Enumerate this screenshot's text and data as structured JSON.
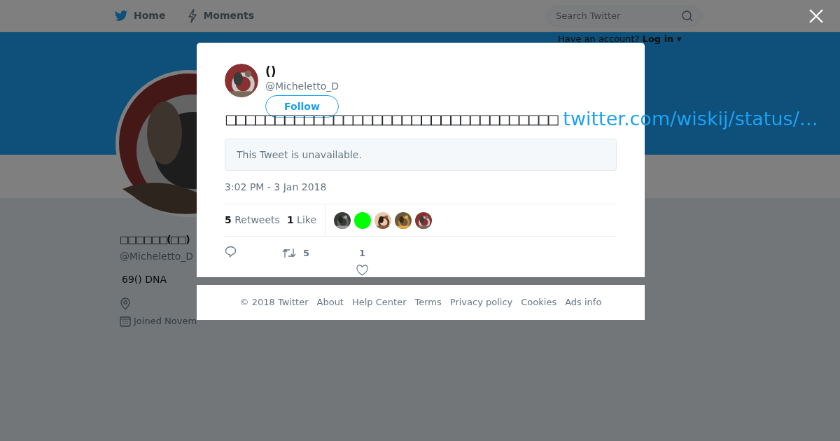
{
  "topbar": {
    "nav": [
      {
        "kind": "home",
        "label": "Home"
      },
      {
        "kind": "moments",
        "label": "Moments"
      }
    ],
    "search": {
      "placeholder": "Search Twitter"
    },
    "login_prompt": {
      "text": "Have an account?",
      "link": "Log in ▾"
    }
  },
  "profile": {
    "name": "□□□□□□(□□)",
    "handle": "@Micheletto_D",
    "bio": "69() DNA",
    "joined": "Joined Novem"
  },
  "tweet": {
    "author_name": "()",
    "author_handle": "@Micheletto_D",
    "follow": "Follow",
    "text": "□□□□□□□□□□□□□□□□□□□□□□□□□□□□□□□□□□",
    "link": "twitter.com/wiskij/status/…",
    "quoted": "This Tweet is unavailable.",
    "timestamp": "3:02 PM - 3 Jan 2018",
    "retweets": {
      "count": "5",
      "label": "Retweets"
    },
    "likes": {
      "count": "1",
      "label": "Like"
    },
    "likers": [
      {
        "kind": "picture"
      },
      {
        "kind": "solid",
        "color": "#00ff00"
      },
      {
        "kind": "picture"
      },
      {
        "kind": "picture"
      },
      {
        "kind": "picture"
      }
    ],
    "actions": [
      {
        "kind": "reply"
      },
      {
        "kind": "retweet",
        "count": "5"
      },
      {
        "kind": "like",
        "count": "1"
      }
    ]
  },
  "footer": [
    "© 2018 Twitter",
    "About",
    "Help Center",
    "Terms",
    "Privacy policy",
    "Cookies",
    "Ads info"
  ]
}
